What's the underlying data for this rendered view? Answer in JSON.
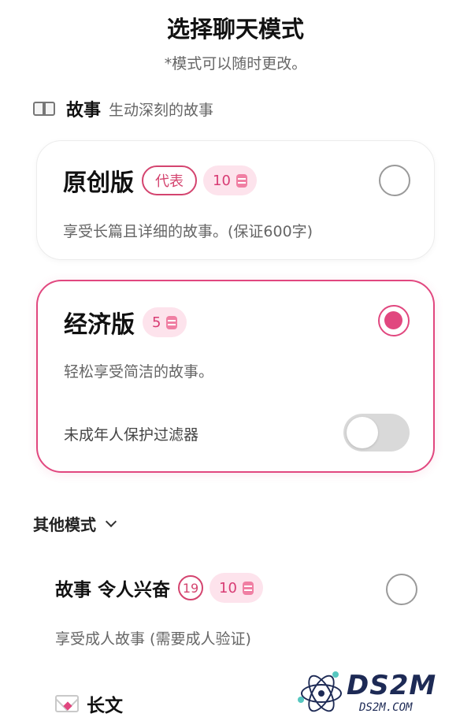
{
  "header": {
    "title": "选择聊天模式",
    "subtitle": "*模式可以随时更改。"
  },
  "story_section": {
    "icon": "open-book-icon",
    "title": "故事",
    "description": "生动深刻的故事"
  },
  "original_card": {
    "title": "原创版",
    "tag": "代表",
    "cost": "10",
    "cost_icon": "coin-jar-icon",
    "description": "享受长篇且详细的故事。(保证600字)",
    "selected": false
  },
  "economy_card": {
    "title": "经济版",
    "cost": "5",
    "cost_icon": "coin-jar-icon",
    "description": "轻松享受简洁的故事。",
    "selected": true,
    "filter_label": "未成年人保护过滤器",
    "filter_enabled": false
  },
  "other_modes": {
    "title": "其他模式",
    "item": {
      "title": "故事 令人兴奋",
      "age_badge": "19",
      "cost": "10",
      "cost_icon": "coin-jar-icon",
      "description": "享受成人故事 (需要成人验证)",
      "selected": false
    }
  },
  "long_section": {
    "icon": "love-letter-icon",
    "title": "长文"
  },
  "watermark": {
    "text": "DS2M",
    "sub": "DS2M.COM"
  },
  "colors": {
    "accent": "#e1477f",
    "badge_bg": "#fde3ec",
    "toggle_off": "#d9d9d9"
  }
}
